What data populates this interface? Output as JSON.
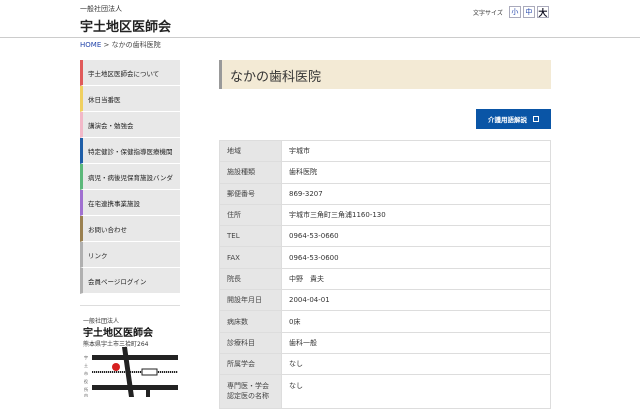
{
  "header": {
    "org": "一般社団法人",
    "site_title": "宇土地区医師会",
    "font_size_label": "文字サイズ",
    "font_sizes": [
      "小",
      "中",
      "大"
    ]
  },
  "breadcrumb": {
    "home": "HOME",
    "sep": " > ",
    "current": "なかの歯科医院"
  },
  "sidebar": {
    "items": [
      {
        "label": "宇土地区医師会について",
        "color": "#e05a5a"
      },
      {
        "label": "休日当番医",
        "color": "#f0d060"
      },
      {
        "label": "講演会・勉強会",
        "color": "#f2b8c8"
      },
      {
        "label": "特定健診・保健指導医療機関",
        "color": "#1f5fa8"
      },
      {
        "label": "病児・病後児保育施設バンダ",
        "color": "#5cb87a"
      },
      {
        "label": "在宅連携事業施設",
        "color": "#a070d0"
      },
      {
        "label": "お問い合わせ",
        "color": "#9a8050"
      },
      {
        "label": "リンク",
        "color": "#b0b0b0"
      },
      {
        "label": "会員ページログイン",
        "color": "#b0b0b0"
      }
    ]
  },
  "map_block": {
    "org": "一般社団法人",
    "title": "宇土地区医師会",
    "address": "熊本県宇土市三拾町264",
    "vertical_label": "宇土市役所内"
  },
  "main": {
    "title": "なかの歯科医院",
    "button": "介護用語解説",
    "rows": [
      {
        "k": "地域",
        "v": "宇城市"
      },
      {
        "k": "施設種類",
        "v": "歯科医院"
      },
      {
        "k": "郵便番号",
        "v": "869-3207"
      },
      {
        "k": "住所",
        "v": "宇城市三角町三角浦1160-130"
      },
      {
        "k": "TEL",
        "v": "0964-53-0660"
      },
      {
        "k": "FAX",
        "v": "0964-53-0600"
      },
      {
        "k": "院長",
        "v": "中野　貴夫"
      },
      {
        "k": "開設年月日",
        "v": "2004-04-01"
      },
      {
        "k": "病床数",
        "v": "0床"
      },
      {
        "k": "診療科目",
        "v": "歯科一般"
      },
      {
        "k": "所属学会",
        "v": "なし"
      },
      {
        "k": "専門医・学会認定医の名称",
        "v": "なし"
      }
    ]
  }
}
